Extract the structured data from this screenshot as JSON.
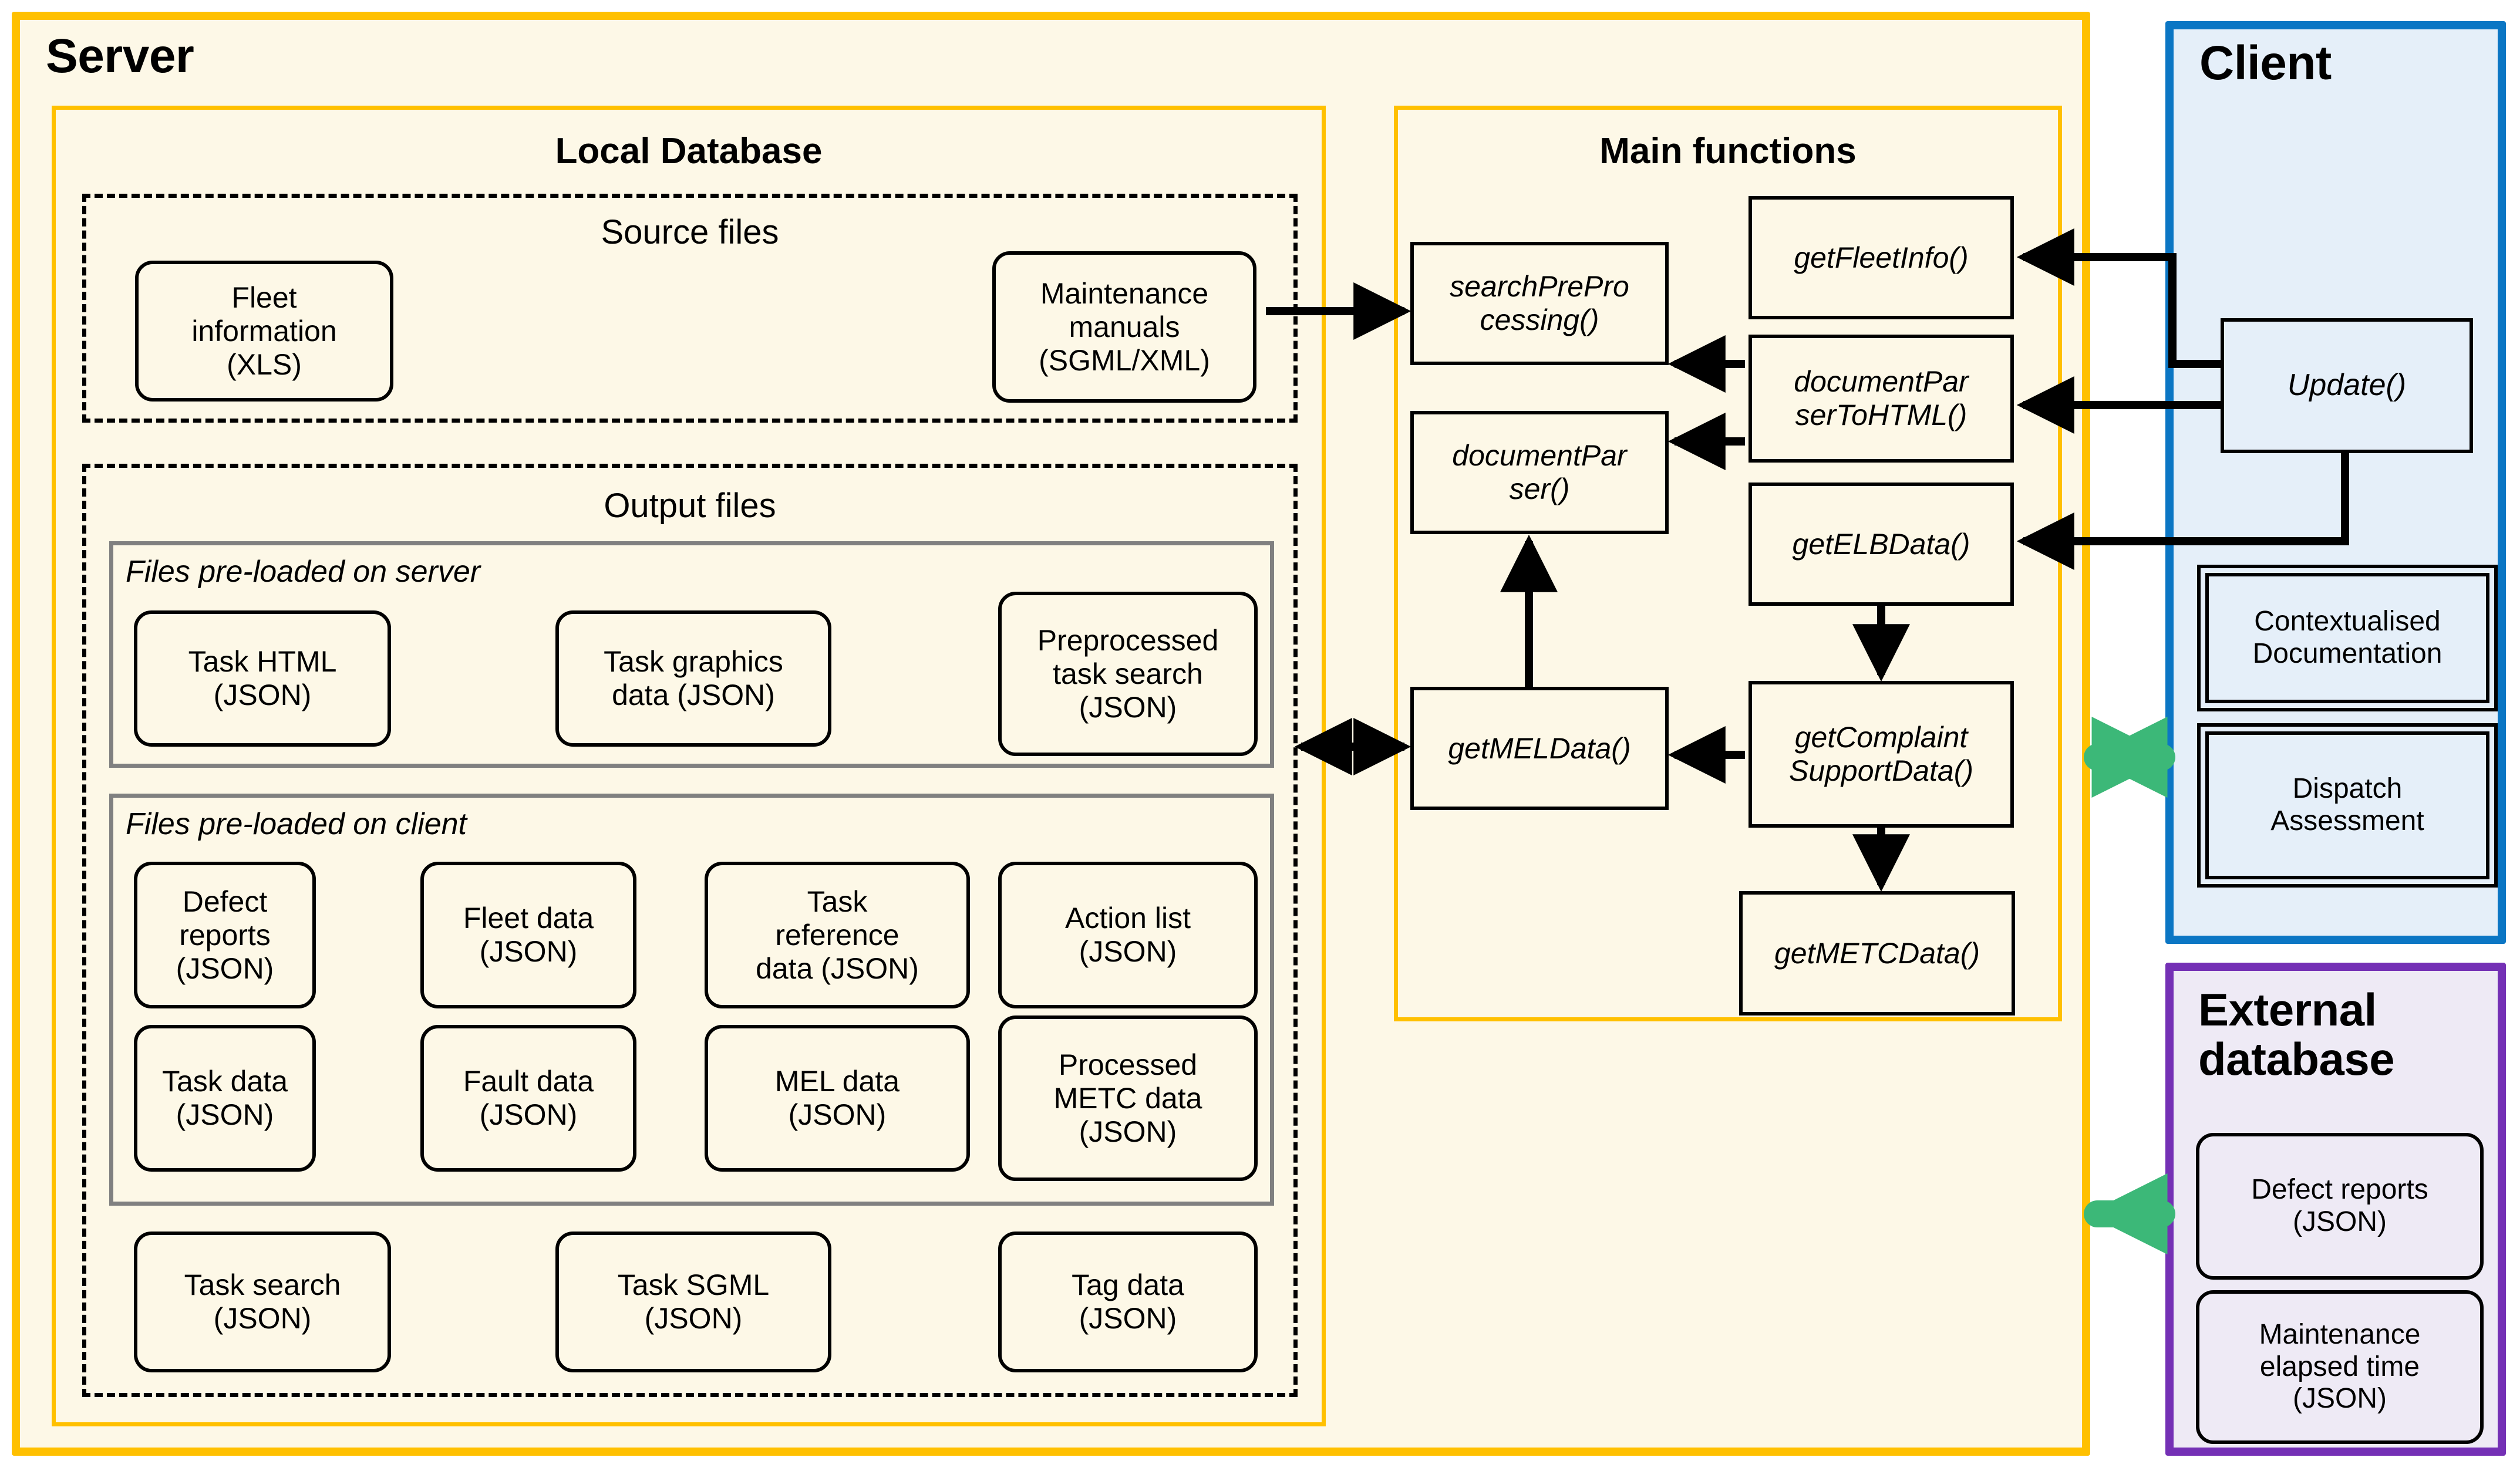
{
  "diagram": {
    "title_server": "Server",
    "title_client": "Client",
    "title_external_db": "External\ndatabase"
  },
  "server": {
    "label": "Server",
    "local_database": {
      "heading": "Local Database",
      "source_files": {
        "heading": "Source files",
        "nodes": [
          {
            "label": "Fleet\ninformation\n(XLS)"
          },
          {
            "label": "Maintenance\nmanuals\n(SGML/XML)"
          }
        ]
      },
      "output_files": {
        "heading": "Output files",
        "preloaded_server": {
          "label": "Files pre-loaded on server",
          "nodes": [
            {
              "label": "Task HTML\n(JSON)"
            },
            {
              "label": "Task graphics\ndata (JSON)"
            },
            {
              "label": "Preprocessed\ntask search\n(JSON)"
            }
          ]
        },
        "preloaded_client": {
          "label": "Files pre-loaded on client",
          "nodes": [
            {
              "label": "Defect\nreports\n(JSON)"
            },
            {
              "label": "Fleet data\n(JSON)"
            },
            {
              "label": "Task\nreference\ndata (JSON)"
            },
            {
              "label": "Action list\n(JSON)"
            },
            {
              "label": "Task data\n(JSON)"
            },
            {
              "label": "Fault data\n(JSON)"
            },
            {
              "label": "MEL data\n(JSON)"
            },
            {
              "label": "Processed\nMETC data\n(JSON)"
            }
          ]
        },
        "loose_nodes": [
          {
            "label": "Task search\n(JSON)"
          },
          {
            "label": "Task SGML\n(JSON)"
          },
          {
            "label": "Tag data\n(JSON)"
          }
        ]
      }
    },
    "main_functions": {
      "heading": "Main functions",
      "nodes": [
        {
          "id": "searchPreProcessing",
          "label": "searchPrePro\ncessing()"
        },
        {
          "id": "documentParser",
          "label": "documentPar\nser()"
        },
        {
          "id": "getMELData",
          "label": "getMELData()"
        },
        {
          "id": "getFleetInfo",
          "label": "getFleetInfo()"
        },
        {
          "id": "documentParserToHTML",
          "label": "documentPar\nserToHTML()"
        },
        {
          "id": "getELBData",
          "label": "getELBData()"
        },
        {
          "id": "getComplaintSupportData",
          "label": "getComplaint\nSupportData()"
        },
        {
          "id": "getMETCData",
          "label": "getMETCData()"
        }
      ]
    }
  },
  "client": {
    "label": "Client",
    "nodes": [
      {
        "id": "update",
        "label": "Update()"
      },
      {
        "id": "contextualised-documentation",
        "label": "Contextualised\nDocumentation"
      },
      {
        "id": "dispatch-assessment",
        "label": "Dispatch\nAssessment"
      }
    ]
  },
  "external_database": {
    "label": "External\ndatabase",
    "nodes": [
      {
        "label": "Defect reports\n(JSON)"
      },
      {
        "label": "Maintenance\nelapsed time\n(JSON)"
      }
    ]
  },
  "colors": {
    "server_border": "#FFC000",
    "server_fill": "#FDF8E7",
    "client_border": "#0B76C4",
    "client_fill": "#E5EFF9",
    "external_border": "#7430B5",
    "external_fill": "#EEEAF5",
    "group_grey": "#808080",
    "arrow_black": "#000000",
    "arrow_green": "#3CB878"
  }
}
